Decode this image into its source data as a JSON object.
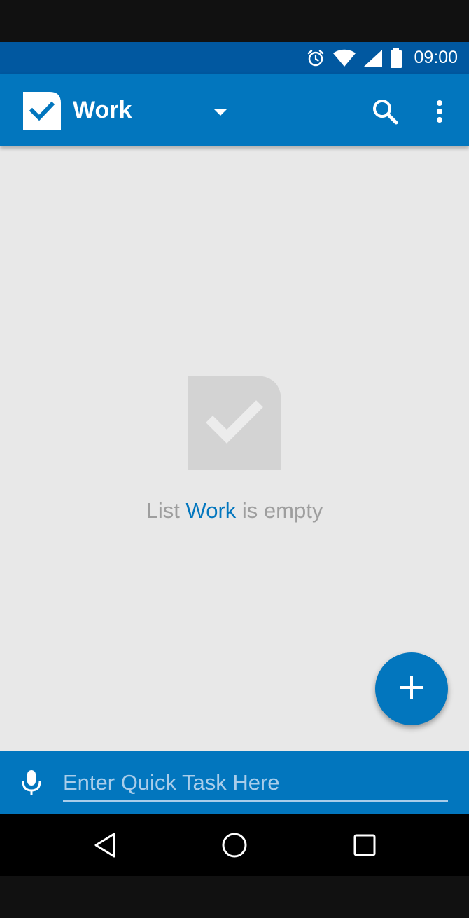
{
  "status_bar": {
    "time": "09:00",
    "icons": [
      "alarm-icon",
      "wifi-icon",
      "signal-icon",
      "battery-icon"
    ]
  },
  "app_bar": {
    "list_title": "Work",
    "icons": [
      "app-logo-icon",
      "dropdown-arrow-icon",
      "search-icon",
      "more-vert-icon"
    ]
  },
  "empty_state": {
    "prefix": "List ",
    "list_name": "Work",
    "suffix": " is empty",
    "icon": "empty-checkbox-icon"
  },
  "fab": {
    "icon": "plus-icon"
  },
  "quick_task": {
    "placeholder": "Enter Quick Task Here",
    "value": "",
    "icon": "microphone-icon"
  },
  "nav_bar": {
    "icons": [
      "back-icon",
      "home-icon",
      "recents-icon"
    ]
  },
  "colors": {
    "status_bar": "#0158a0",
    "primary": "#0276be",
    "background": "#e8e8e8",
    "empty_text": "#9e9e9e"
  }
}
